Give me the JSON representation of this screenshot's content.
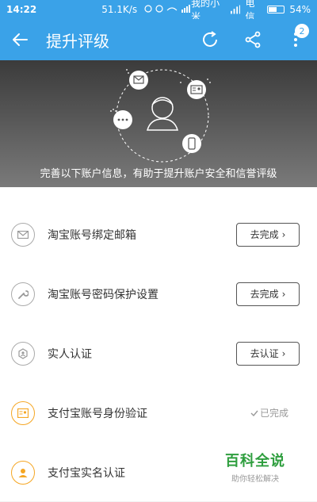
{
  "status_bar": {
    "time": "14:22",
    "net_speed": "51.1K/s",
    "carrier1": "我的小米",
    "carrier2": "电信",
    "battery_text": "54%",
    "battery_level": 0.54
  },
  "app_bar": {
    "title": "提升评级",
    "badge_count": "2"
  },
  "hero": {
    "caption": "完善以下账户信息，有助于提升账户安全和信誉评级"
  },
  "list": {
    "items": [
      {
        "label": "淘宝账号绑定邮箱",
        "action": "去完成",
        "icon": "mail-icon",
        "status": "pending"
      },
      {
        "label": "淘宝账号密码保护设置",
        "action": "去完成",
        "icon": "wrench-icon",
        "status": "pending"
      },
      {
        "label": "实人认证",
        "action": "去认证",
        "icon": "id-shield-icon",
        "status": "pending"
      },
      {
        "label": "支付宝账号身份验证",
        "action": "已完成",
        "icon": "id-card-icon",
        "status": "done"
      },
      {
        "label": "支付宝实名认证",
        "action": "",
        "icon": "person-icon",
        "status": "none"
      }
    ]
  },
  "watermark": {
    "title": "百科全说",
    "subtitle": "助你轻松解决"
  },
  "colors": {
    "primary": "#3aa2e8",
    "accent_orange": "#f5a623",
    "watermark_green": "#2e9e3e"
  }
}
